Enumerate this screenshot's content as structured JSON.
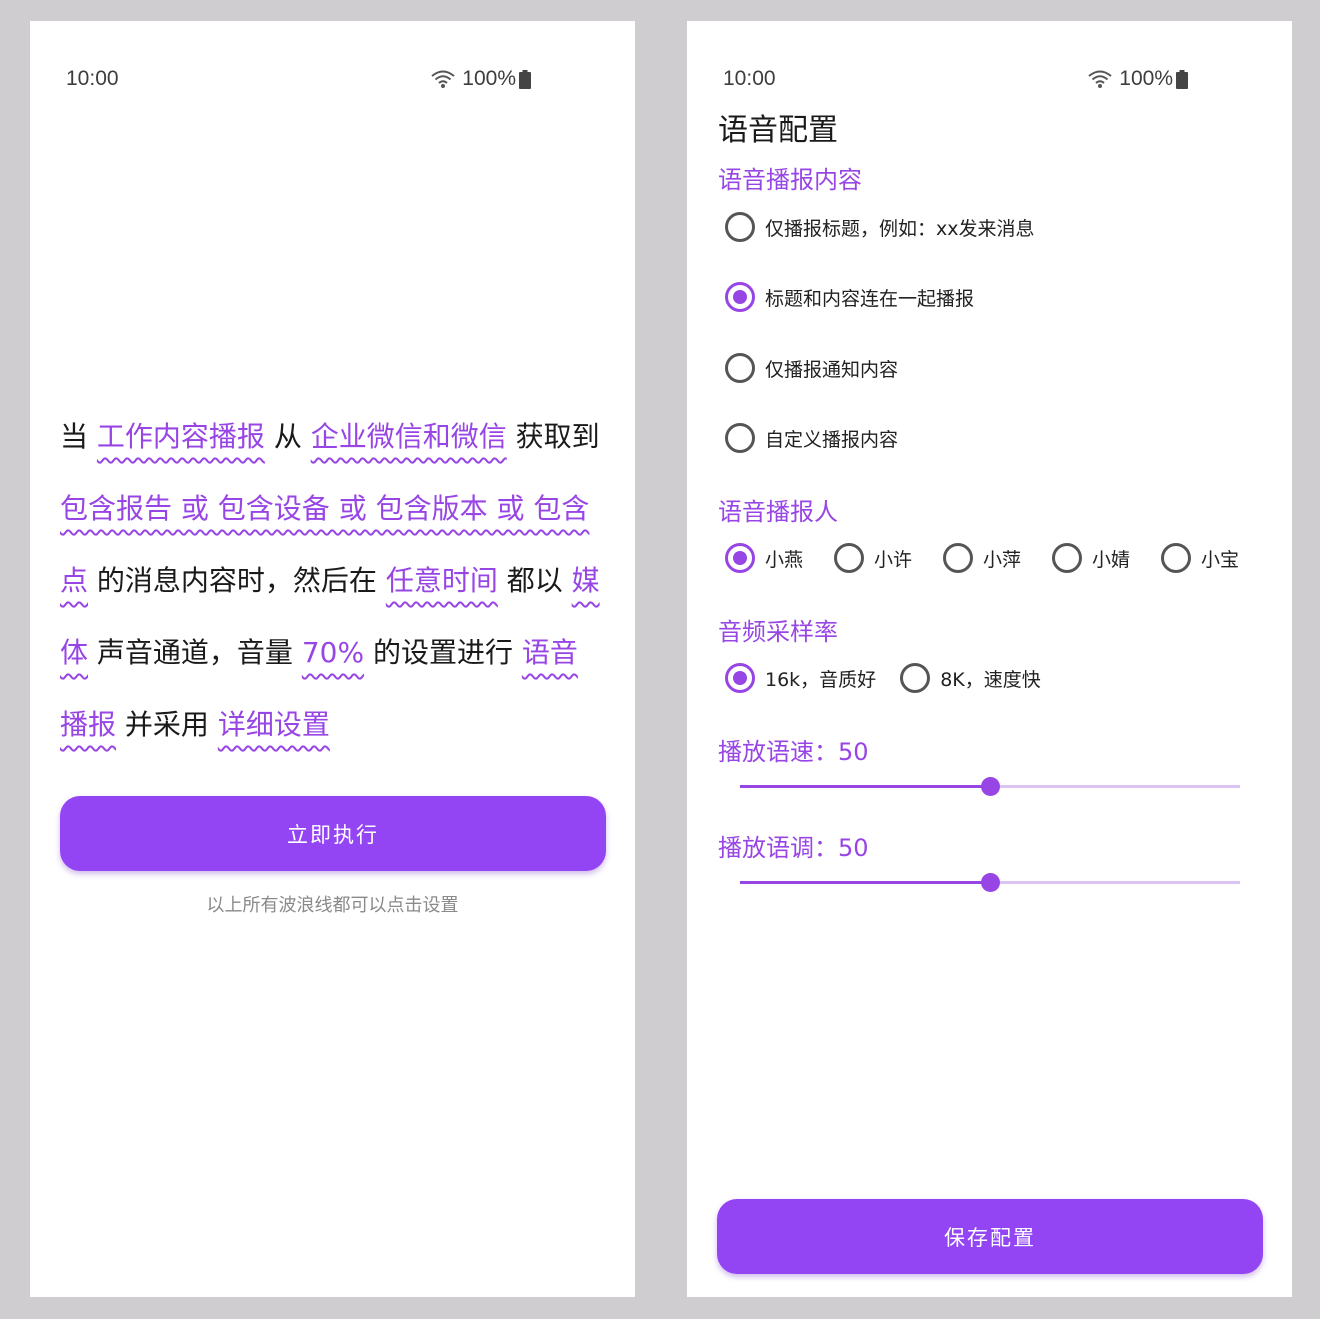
{
  "status": {
    "time": "10:00",
    "battery": "100%"
  },
  "left": {
    "sentence": [
      {
        "text": "当 ",
        "link": false
      },
      {
        "text": "工作内容播报",
        "link": true
      },
      {
        "text": " 从 ",
        "link": false
      },
      {
        "text": "企业微信和微信",
        "link": true
      },
      {
        "text": " 获取到 ",
        "link": false
      },
      {
        "text": "包含报告 或 包含设备 或 包含版本 或 包含点",
        "link": true
      },
      {
        "text": " 的消息内容时，然后在 ",
        "link": false
      },
      {
        "text": "任意时间",
        "link": true
      },
      {
        "text": " 都以 ",
        "link": false
      },
      {
        "text": "媒体",
        "link": true
      },
      {
        "text": " 声音通道，音量 ",
        "link": false
      },
      {
        "text": "70%",
        "link": true
      },
      {
        "text": " 的设置进行 ",
        "link": false
      },
      {
        "text": "语音播报",
        "link": true
      },
      {
        "text": " 并采用 ",
        "link": false
      },
      {
        "text": "详细设置",
        "link": true
      }
    ],
    "run_button": "立即执行",
    "hint": "以上所有波浪线都可以点击设置"
  },
  "right": {
    "title": "语音配置",
    "content_section": "语音播报内容",
    "content_options": [
      {
        "label": "仅播报标题，例如：xx发来消息",
        "selected": false
      },
      {
        "label": "标题和内容连在一起播报",
        "selected": true
      },
      {
        "label": "仅播报通知内容",
        "selected": false
      },
      {
        "label": "自定义播报内容",
        "selected": false
      }
    ],
    "speaker_section": "语音播报人",
    "speakers": [
      {
        "label": "小燕",
        "selected": true
      },
      {
        "label": "小许",
        "selected": false
      },
      {
        "label": "小萍",
        "selected": false
      },
      {
        "label": "小婧",
        "selected": false
      },
      {
        "label": "小宝",
        "selected": false
      }
    ],
    "rate_section": "音频采样率",
    "rates": [
      {
        "label": "16k，音质好",
        "selected": true
      },
      {
        "label": "8K，速度快",
        "selected": false
      }
    ],
    "speed_label": "播放语速：50",
    "speed_value": 50,
    "pitch_label": "播放语调：50",
    "pitch_value": 50,
    "slider_max": 100,
    "save_button": "保存配置"
  },
  "colors": {
    "accent": "#9845e6",
    "button": "#9345f4"
  }
}
